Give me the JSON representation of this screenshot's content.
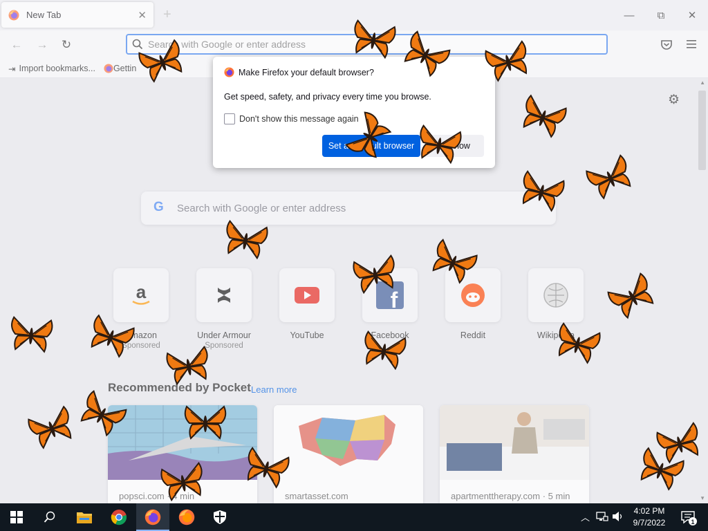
{
  "tab": {
    "title": "New Tab",
    "close": "✕",
    "new_tab": "+"
  },
  "window": {
    "minimize": "—",
    "maximize": "⧉",
    "close": "✕"
  },
  "nav": {
    "back": "←",
    "forward": "→",
    "reload": "↻",
    "url_placeholder": "Search with Google or enter address"
  },
  "bookmarks": [
    {
      "label": "Import bookmarks...",
      "icon": "import-icon"
    },
    {
      "label": "Gettin",
      "icon": "firefox-icon"
    }
  ],
  "dialog": {
    "title": "Make Firefox your default browser?",
    "body": "Get speed, safety, and privacy every time you browse.",
    "checkbox_label": "Don't show this message again",
    "primary": "Set as default browser",
    "secondary": "Not now"
  },
  "page": {
    "search_placeholder": "Search with Google or enter address",
    "top_sites": [
      {
        "name": "Amazon",
        "sponsored": "Sponsored"
      },
      {
        "name": "Under Armour",
        "sponsored": "Sponsored"
      },
      {
        "name": "YouTube",
        "sponsored": ""
      },
      {
        "name": "Facebook",
        "sponsored": ""
      },
      {
        "name": "Reddit",
        "sponsored": ""
      },
      {
        "name": "Wikipedia",
        "sponsored": ""
      }
    ],
    "recommended_heading": "Recommended by Pocket",
    "learn_more": "Learn more",
    "cards": [
      {
        "source": "popsci.com · 4 min"
      },
      {
        "source": "smartasset.com"
      },
      {
        "source": "apartmenttherapy.com · 5 min"
      }
    ]
  },
  "taskbar": {
    "time": "4:02 PM",
    "date": "9/7/2022",
    "notifications": "1"
  },
  "colors": {
    "accent": "#0061e0",
    "url_focus": "#3b80f0",
    "butterfly_orange": "#f07a12",
    "taskbar": "#101820"
  }
}
